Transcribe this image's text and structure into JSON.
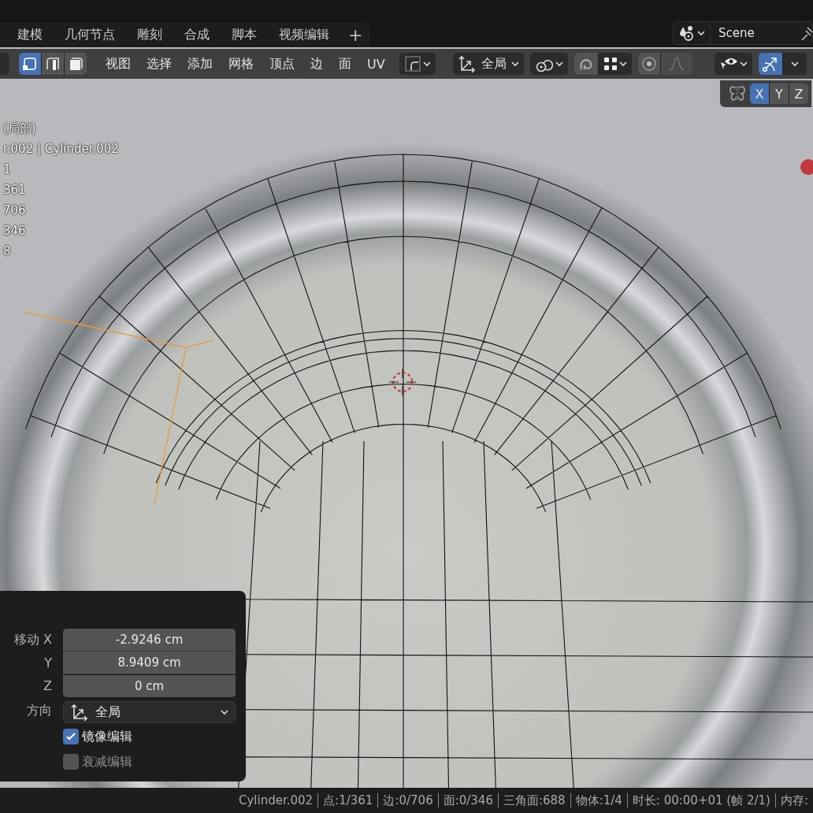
{
  "workspace_tabs": [
    {
      "label": "建模"
    },
    {
      "label": "几何节点"
    },
    {
      "label": "雕刻"
    },
    {
      "label": "合成"
    },
    {
      "label": "脚本"
    },
    {
      "label": "视频编辑"
    }
  ],
  "add_tab": "+",
  "scene": {
    "name": "Scene"
  },
  "header": {
    "select_modes": [
      {
        "selected": true
      },
      {
        "selected": false
      },
      {
        "selected": false
      }
    ],
    "menus": [
      "视图",
      "选择",
      "添加",
      "网格",
      "顶点",
      "边",
      "面",
      "UV"
    ],
    "orientation": "全局",
    "gizmo": {
      "selected": true
    },
    "mirror_axes": [
      {
        "label": "X",
        "selected": true
      },
      {
        "label": "Y",
        "selected": false
      },
      {
        "label": "Z",
        "selected": false
      }
    ]
  },
  "viewport_overlay": {
    "mode": "(局部)",
    "object": "r.002 | Cylinder.002",
    "stats": [
      "1",
      "361",
      "706",
      "346",
      "8"
    ]
  },
  "operator_panel": {
    "fields": [
      {
        "label": "移动 X",
        "value": "-2.9246 cm"
      },
      {
        "label": "Y",
        "value": "8.9409 cm"
      },
      {
        "label": "Z",
        "value": "0 cm"
      }
    ],
    "orientation": {
      "label": "方向",
      "value": "全局"
    },
    "checkboxes": [
      {
        "label": "镜像编辑",
        "checked": true
      },
      {
        "label": "衰减编辑",
        "checked": false
      }
    ]
  },
  "status_bar": [
    "Cylinder.002",
    "点:1/361",
    "边:0/706",
    "面:0/346",
    "三角面:688",
    "物体:1/4",
    "时长: 00:00+01 (帧 2/1)",
    "内存:"
  ]
}
